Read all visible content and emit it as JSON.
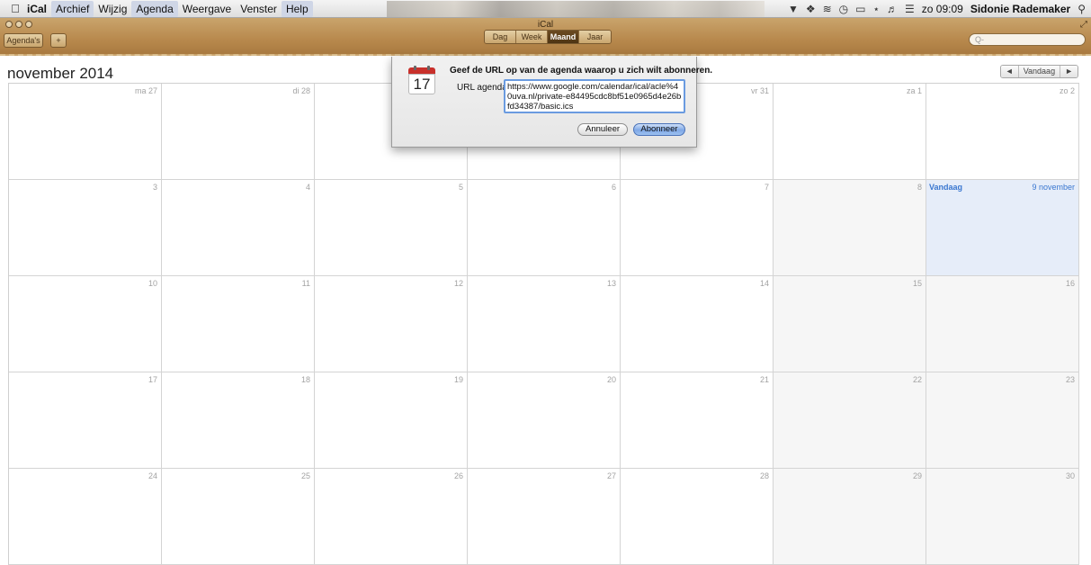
{
  "menubar": {
    "apple_icon": "apple-icon",
    "items": [
      {
        "label": "iCal",
        "app": true,
        "highlight": false
      },
      {
        "label": "Archief",
        "app": false,
        "highlight": true
      },
      {
        "label": "Wijzig",
        "app": false,
        "highlight": false
      },
      {
        "label": "Agenda",
        "app": false,
        "highlight": true
      },
      {
        "label": "Weergave",
        "app": false,
        "highlight": false
      },
      {
        "label": "Venster",
        "app": false,
        "highlight": false
      },
      {
        "label": "Help",
        "app": false,
        "highlight": true
      }
    ],
    "status_icons": [
      "vpn-icon",
      "dropbox-icon",
      "wifi-icon",
      "time-machine-icon",
      "battery-icon",
      "bluetooth-icon",
      "volume-icon",
      "flag-icon"
    ],
    "clock": "zo 09:09",
    "user": "Sidonie Rademaker",
    "spotlight_icon": "spotlight-icon"
  },
  "window": {
    "title": "iCal",
    "calendars_button": "Agenda's",
    "add_button": "+",
    "views": [
      {
        "label": "Dag",
        "active": false
      },
      {
        "label": "Week",
        "active": false
      },
      {
        "label": "Maand",
        "active": true
      },
      {
        "label": "Jaar",
        "active": false
      }
    ],
    "search_placeholder": "Q-"
  },
  "calendar": {
    "month_title": "november 2014",
    "nav": {
      "prev": "◄",
      "today": "Vandaag",
      "next": "►"
    },
    "today_label": "Vandaag",
    "today_date": "9 november",
    "weeks": [
      [
        "ma 27",
        "di 28",
        "",
        "",
        "vr 31",
        "za 1",
        "zo 2"
      ],
      [
        "3",
        "4",
        "5",
        "6",
        "7",
        "8",
        "9"
      ],
      [
        "10",
        "11",
        "12",
        "13",
        "14",
        "15",
        "16"
      ],
      [
        "17",
        "18",
        "19",
        "20",
        "21",
        "22",
        "23"
      ],
      [
        "24",
        "25",
        "26",
        "27",
        "28",
        "29",
        "30"
      ]
    ]
  },
  "dialog": {
    "icon_day": "17",
    "title": "Geef de URL op van de agenda waarop u zich wilt abonneren.",
    "url_label": "URL agenda:",
    "url_value": "https://www.google.com/calendar/ical/acle%40uva.nl/private-e84495cdc8bf51e0965d4e26bfd34387/basic.ics",
    "cancel_label": "Annuleer",
    "subscribe_label": "Abonneer"
  },
  "colors": {
    "toolbar": "#b8894d",
    "today_bg": "#e6edf9",
    "today_text": "#3a77d0",
    "default_button": "#7fa8e6"
  }
}
